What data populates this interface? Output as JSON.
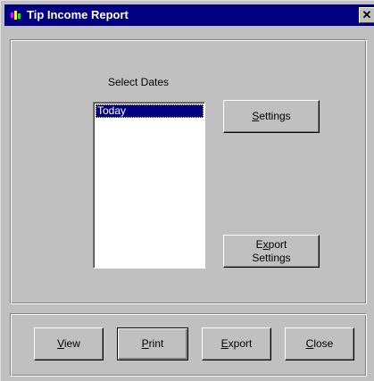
{
  "window": {
    "title": "Tip Income Report",
    "close_glyph": "✕",
    "title_icon": "app-icon",
    "colors": {
      "titlebar": "#000080",
      "face": "#c0c0c0",
      "selection": "#000080"
    }
  },
  "dates": {
    "label": "Select Dates",
    "items": [
      "Today"
    ],
    "selected": "Today"
  },
  "buttons": {
    "settings": {
      "mnemonic": "S",
      "rest": "ettings"
    },
    "export_settings": {
      "line1_pre": "E",
      "line1_mnemonic": "x",
      "line1_post": "port",
      "line2": "Settings"
    },
    "view": {
      "mnemonic": "V",
      "rest": "iew"
    },
    "print": {
      "mnemonic": "P",
      "rest": "rint"
    },
    "export": {
      "mnemonic": "E",
      "rest": "xport"
    },
    "close": {
      "mnemonic": "C",
      "rest": "lose"
    }
  }
}
